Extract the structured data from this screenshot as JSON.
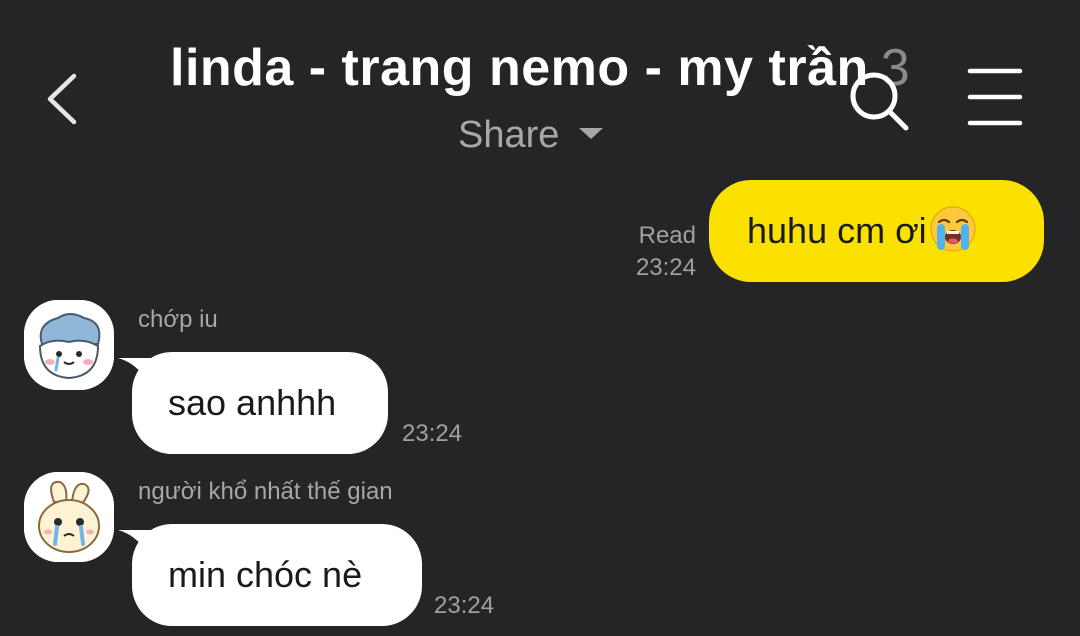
{
  "header": {
    "title": "linda - trang nemo - my trần",
    "member_count": "3",
    "subtitle": "Share"
  },
  "icons": {
    "back": "chevron-left-icon",
    "search": "search-icon",
    "menu": "hamburger-menu-icon"
  },
  "colors": {
    "background": "#252527",
    "outgoing_bubble": "#fae100",
    "incoming_bubble": "#ffffff",
    "meta_text": "#a0a0a2"
  },
  "messages": [
    {
      "direction": "outgoing",
      "text": "huhu cm ơi",
      "emoji": "loudly-crying-face",
      "status": "Read",
      "time": "23:24"
    },
    {
      "direction": "incoming",
      "sender": "chớp iu",
      "text": "sao anhhh",
      "time": "23:24"
    },
    {
      "direction": "incoming",
      "sender": "người khổ nhất thế gian",
      "text": "min chóc nè",
      "time": "23:24"
    }
  ]
}
